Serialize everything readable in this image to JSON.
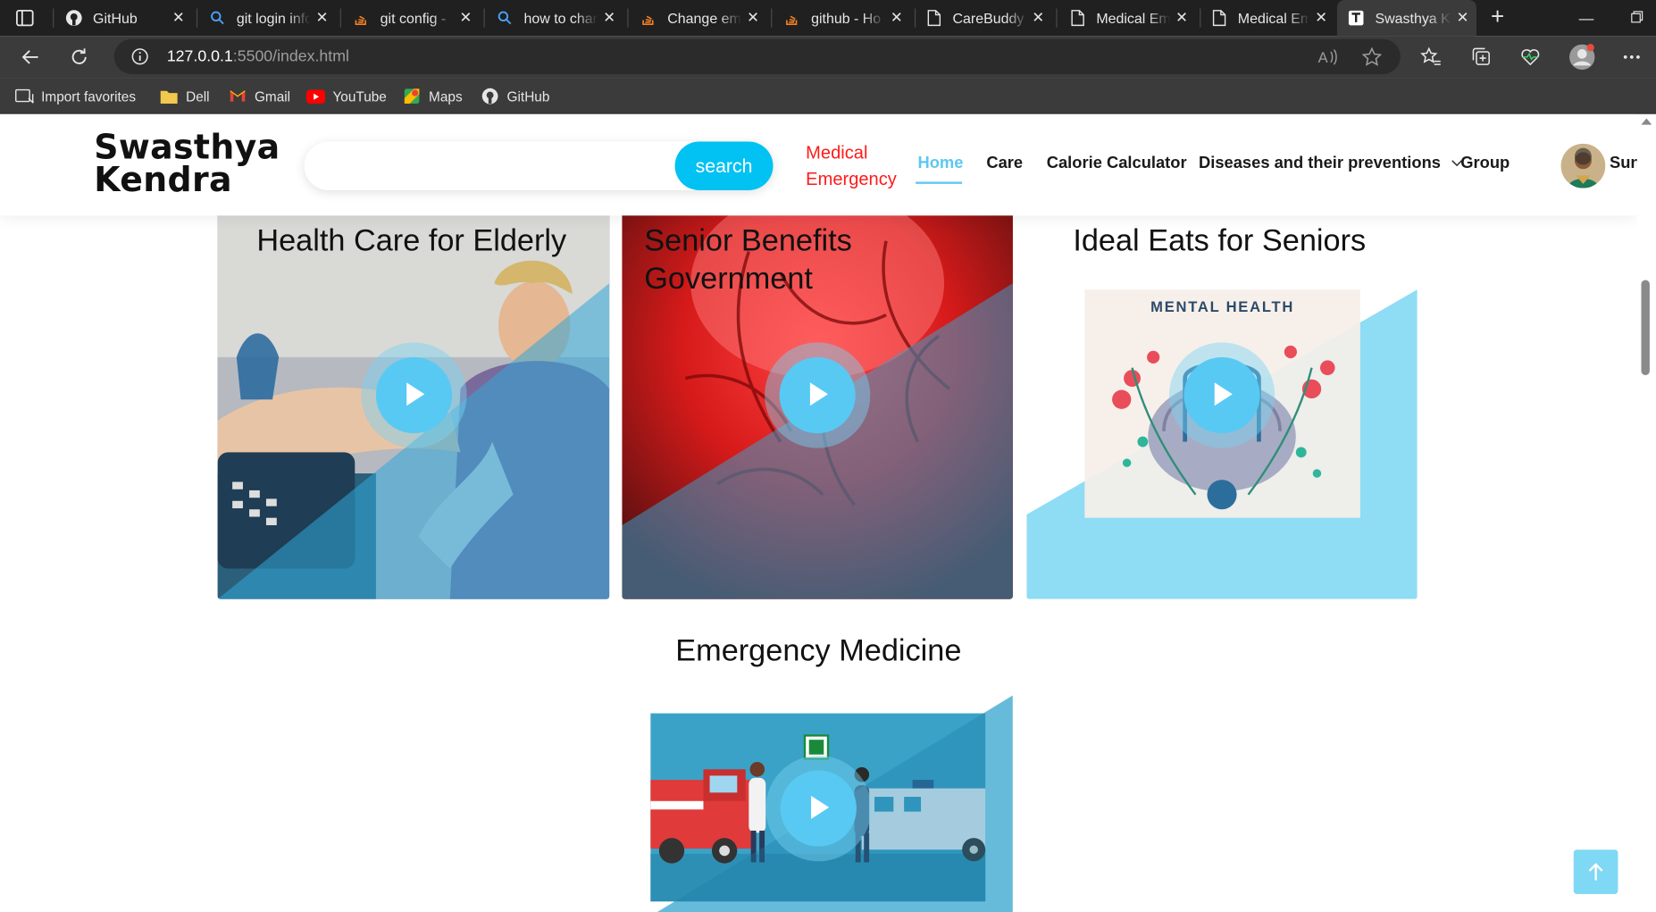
{
  "browser": {
    "tabs": [
      {
        "title": "GitHub",
        "icon": "github-icon"
      },
      {
        "title": "git login info",
        "icon": "search-icon"
      },
      {
        "title": "git config -",
        "icon": "stackoverflow-icon"
      },
      {
        "title": "how to chan",
        "icon": "search-icon"
      },
      {
        "title": "Change em",
        "icon": "stackoverflow-icon"
      },
      {
        "title": "github - Ho",
        "icon": "stackoverflow-icon"
      },
      {
        "title": "CareBuddy",
        "icon": "file-icon"
      },
      {
        "title": "Medical Em",
        "icon": "file-icon"
      },
      {
        "title": "Medical Em",
        "icon": "file-icon"
      },
      {
        "title": "Swasthya K",
        "icon": "site-icon"
      }
    ],
    "url_host": "127.0.0.1",
    "url_rest": ":5500/index.html",
    "favorites": [
      {
        "label": "Import favorites",
        "icon": "import-icon"
      },
      {
        "label": "Dell",
        "icon": "folder-icon"
      },
      {
        "label": "Gmail",
        "icon": "gmail-icon"
      },
      {
        "label": "YouTube",
        "icon": "youtube-icon"
      },
      {
        "label": "Maps",
        "icon": "maps-icon"
      },
      {
        "label": "GitHub",
        "icon": "github-icon"
      }
    ]
  },
  "site": {
    "logo_line1": "Swasthya",
    "logo_line2": "Kendra",
    "search_placeholder": "",
    "search_button": "search",
    "nav": {
      "emergency_line1": "Medical",
      "emergency_line2": "Emergency",
      "home": "Home",
      "care": "Care",
      "calorie": "Calorie Calculator",
      "diseases": "Diseases and their preventions",
      "group": "Group",
      "user": "Sun"
    },
    "colors": {
      "accent": "#01c2f2",
      "emergency": "#ff1a1a",
      "active_nav": "#5bc8f0"
    }
  },
  "cards": {
    "elderly": "Health Care for Elderly",
    "benefits": "Senior Benefits Government",
    "eats": "Ideal Eats for Seniors",
    "eats_image_text": "MENTAL HEALTH",
    "emergency_section": "Emergency Medicine"
  }
}
